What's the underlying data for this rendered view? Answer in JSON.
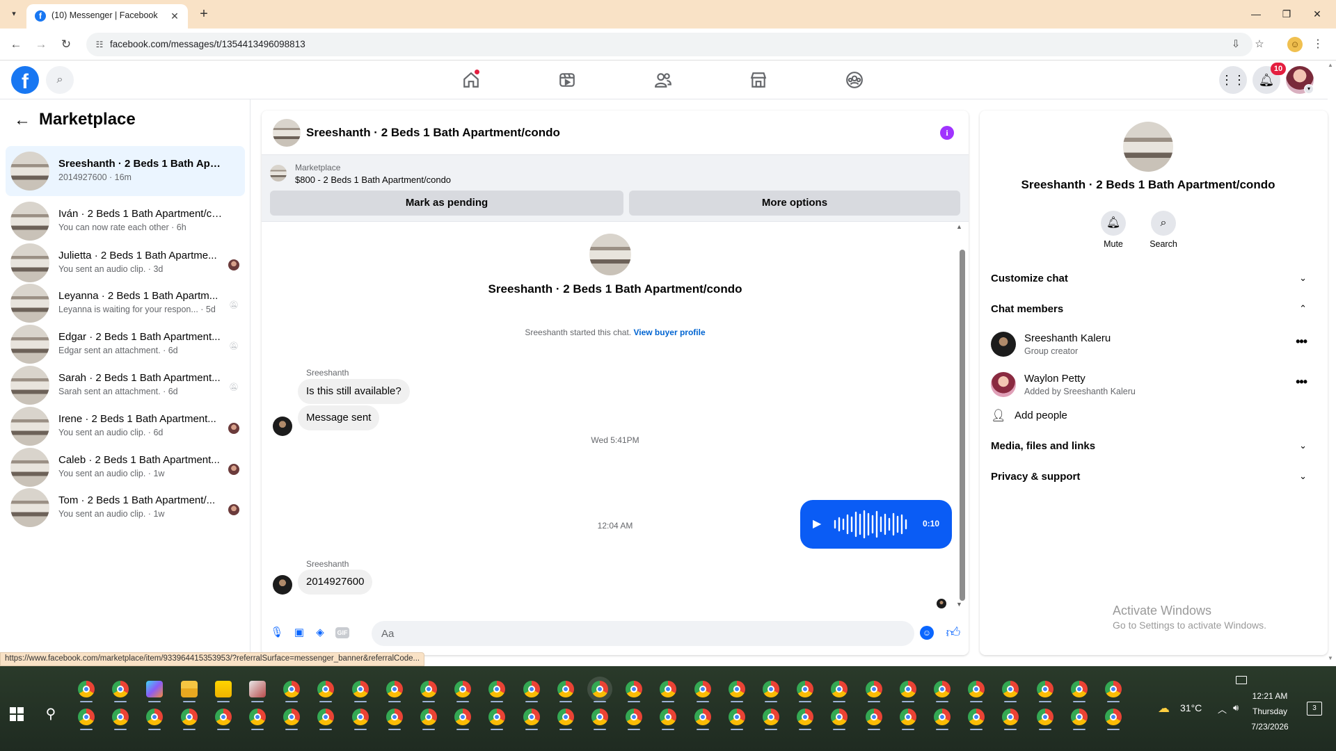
{
  "browser": {
    "tab_title": "(10) Messenger | Facebook",
    "url": "facebook.com/messages/t/1354413496098813",
    "status_url": "https://www.facebook.com/marketplace/item/933964415353953/?referralSurface=messenger_banner&referralCode..."
  },
  "fbnav": {
    "notification_count": "10"
  },
  "left_panel": {
    "title": "Marketplace",
    "conversations": [
      {
        "name": "Sreeshanth · 2 Beds 1 Bath Apartm...",
        "preview": "2014927600 · 16m",
        "active": true,
        "side": ""
      },
      {
        "name": "Iván · 2 Beds 1 Bath Apartment/co...",
        "preview": "You can now rate each other · 6h",
        "active": false,
        "side": ""
      },
      {
        "name": "Julietta · 2 Beds 1 Bath Apartme...",
        "preview": "You sent an audio clip. · 3d",
        "active": false,
        "side": "avatar"
      },
      {
        "name": "Leyanna · 2 Beds 1 Bath Apartm...",
        "preview": "Leyanna is waiting for your respon... · 5d",
        "active": false,
        "side": "muted"
      },
      {
        "name": "Edgar · 2 Beds 1 Bath Apartment...",
        "preview": "Edgar sent an attachment. · 6d",
        "active": false,
        "side": "muted"
      },
      {
        "name": "Sarah · 2 Beds 1 Bath Apartment...",
        "preview": "Sarah sent an attachment. · 6d",
        "active": false,
        "side": "muted"
      },
      {
        "name": "Irene · 2 Beds 1 Bath Apartment...",
        "preview": "You sent an audio clip. · 6d",
        "active": false,
        "side": "avatar"
      },
      {
        "name": "Caleb · 2 Beds 1 Bath Apartment...",
        "preview": "You sent an audio clip. · 1w",
        "active": false,
        "side": "avatar"
      },
      {
        "name": "Tom · 2 Beds 1 Bath Apartment/...",
        "preview": "You sent an audio clip. · 1w",
        "active": false,
        "side": "avatar"
      }
    ]
  },
  "chat": {
    "header_title": "Sreeshanth · 2 Beds 1 Bath Apartment/condo",
    "marketplace_label": "Marketplace",
    "listing": "$800 - 2 Beds 1 Bath Apartment/condo",
    "mark_pending": "Mark as pending",
    "more_options": "More options",
    "intro_name": "Sreeshanth · 2 Beds 1 Bath Apartment/condo",
    "system_msg": "Sreeshanth started this chat.",
    "system_link": "View buyer profile",
    "sender_name_1": "Sreeshanth",
    "msg_1": "Is this still available?",
    "msg_2": "Message sent",
    "ts_1": "Wed 5:41PM",
    "audio_duration": "0:10",
    "ts_2": "12:04 AM",
    "sender_name_2": "Sreeshanth",
    "msg_3": "2014927600",
    "composer_placeholder": "Aa"
  },
  "right_panel": {
    "name": "Sreeshanth · 2 Beds 1 Bath Apartment/condo",
    "mute_label": "Mute",
    "search_label": "Search",
    "customize_chat": "Customize chat",
    "chat_members": "Chat members",
    "members": [
      {
        "name": "Sreeshanth Kaleru",
        "role": "Group creator"
      },
      {
        "name": "Waylon Petty",
        "role": "Added by Sreeshanth Kaleru"
      }
    ],
    "add_people": "Add people",
    "media_files_links": "Media, files and links",
    "privacy_support": "Privacy & support"
  },
  "watermark": {
    "line1": "Activate Windows",
    "line2": "Go to Settings to activate Windows."
  },
  "taskbar": {
    "temperature": "31°C",
    "time": "12:21 AM",
    "day": "Thursday",
    "date": "7/23/2026",
    "notification_count": "3"
  }
}
